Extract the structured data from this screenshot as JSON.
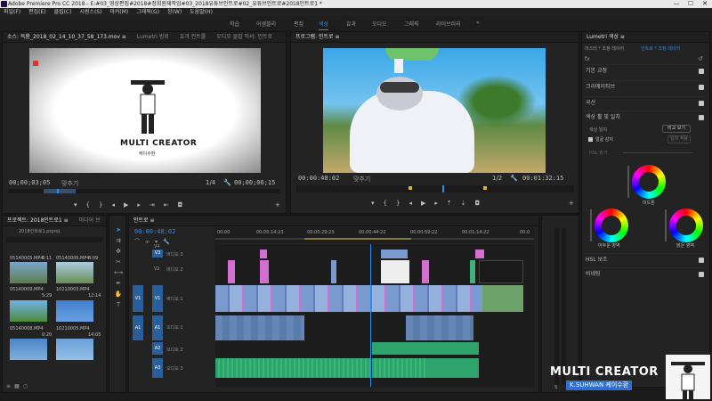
{
  "window": {
    "title": "Adobe Premiere Pro CC 2018 - E:#03_영상편집#2018#정회원재작업#03_2018유튜브인트로#02_유튜브인트로#2018인트로1 *",
    "min": "—",
    "max": "☐",
    "close": "✕"
  },
  "menu": [
    "파일(F)",
    "편집(E)",
    "클립(C)",
    "시퀀스(S)",
    "마커(M)",
    "그래픽(G)",
    "창(W)",
    "도움말(H)"
  ],
  "workspaces": [
    "학습",
    "어셈블리",
    "편집",
    "색상",
    "효과",
    "오디오",
    "그래픽",
    "라이브러리"
  ],
  "workspace_more": "»",
  "source": {
    "tabs": [
      "소스: 득환_2018_02_14_10_37_58_173.mov ≡",
      "Lumetri 범위",
      "효과 컨트롤",
      "오디오 클립 믹서: 인트로"
    ],
    "logo_brand": "MULTI CREATOR",
    "logo_sub": "케이수환",
    "tc_current": "00;00;03;05",
    "fit": "맞추기",
    "fraction": "1/4",
    "tc_duration": "00;00;06;15"
  },
  "program": {
    "tabs": [
      "프로그램: 인트로 ≡"
    ],
    "tc_current": "00:00:48:02",
    "fit": "맞추기",
    "fraction": "1/2",
    "tc_duration": "00:01:32:15"
  },
  "lumetri": {
    "title": "Lumetri 색상 ≡",
    "breadcrumb_left": "마스터 * 조정 레이어",
    "breadcrumb_right": "인트로 * 조정 레이어",
    "fx": "fx",
    "sections": [
      "기본 교정",
      "크리에이티브",
      "곡선",
      "색상 휠 및 일치"
    ],
    "color_match": "색상 일치",
    "compare_btn": "비교 보기",
    "face_detect": "얼굴 감지",
    "match_btn": "일치 적용",
    "hsl_balance": "HSL 밝기",
    "midtones": "미드톤",
    "shadows": "어두운 영역",
    "highlights": "밝은 영역",
    "hsl_sub": "HSL 보조",
    "vignette": "비네팅"
  },
  "project": {
    "tabs": [
      "프로젝트: 2018인트로1 ≡",
      "미디어 브"
    ],
    "file": "2018인트로1.prproj",
    "items": [
      {
        "name": "05140005.MP4",
        "dur": "3:11"
      },
      {
        "name": "05140006.MP4",
        "dur": "4:09"
      },
      {
        "name": "05140009.MP4",
        "dur": "5:29"
      },
      {
        "name": "10210003.MP4",
        "dur": "12:14"
      },
      {
        "name": "05140008.MP4",
        "dur": "0:20"
      },
      {
        "name": "10210005.MP4",
        "dur": "14:05"
      }
    ]
  },
  "timeline": {
    "tab": "인트로 ≡",
    "tc": "00:00:48:02",
    "ruler": [
      "00:00",
      "00:00:14:23",
      "00:00:29:23",
      "00:00:44:22",
      "00:00:59:22",
      "00:01:14:22",
      "00:0"
    ],
    "tracks": [
      {
        "id": "V3",
        "name": "비디오 3"
      },
      {
        "id": "V2",
        "name": "비디오 2"
      },
      {
        "id": "V1",
        "name": "비디오 1"
      },
      {
        "id": "A1",
        "name": "오디오 1"
      },
      {
        "id": "A2",
        "name": "오디오 2"
      },
      {
        "id": "A3",
        "name": "오디오 3"
      }
    ],
    "v1_source": "V1",
    "a1_source": "A1",
    "v4": "V4"
  },
  "watermark": {
    "brand": "MULTI CREATOR",
    "sub": "K.SUHWAN 케이수환"
  },
  "colors": {
    "accent": "#2d8ceb",
    "video_clip": "#7a9bd0",
    "audio_clip": "#2ea36b",
    "pink_clip": "#d36fd0",
    "adjust_clip": "#b49a3b"
  }
}
